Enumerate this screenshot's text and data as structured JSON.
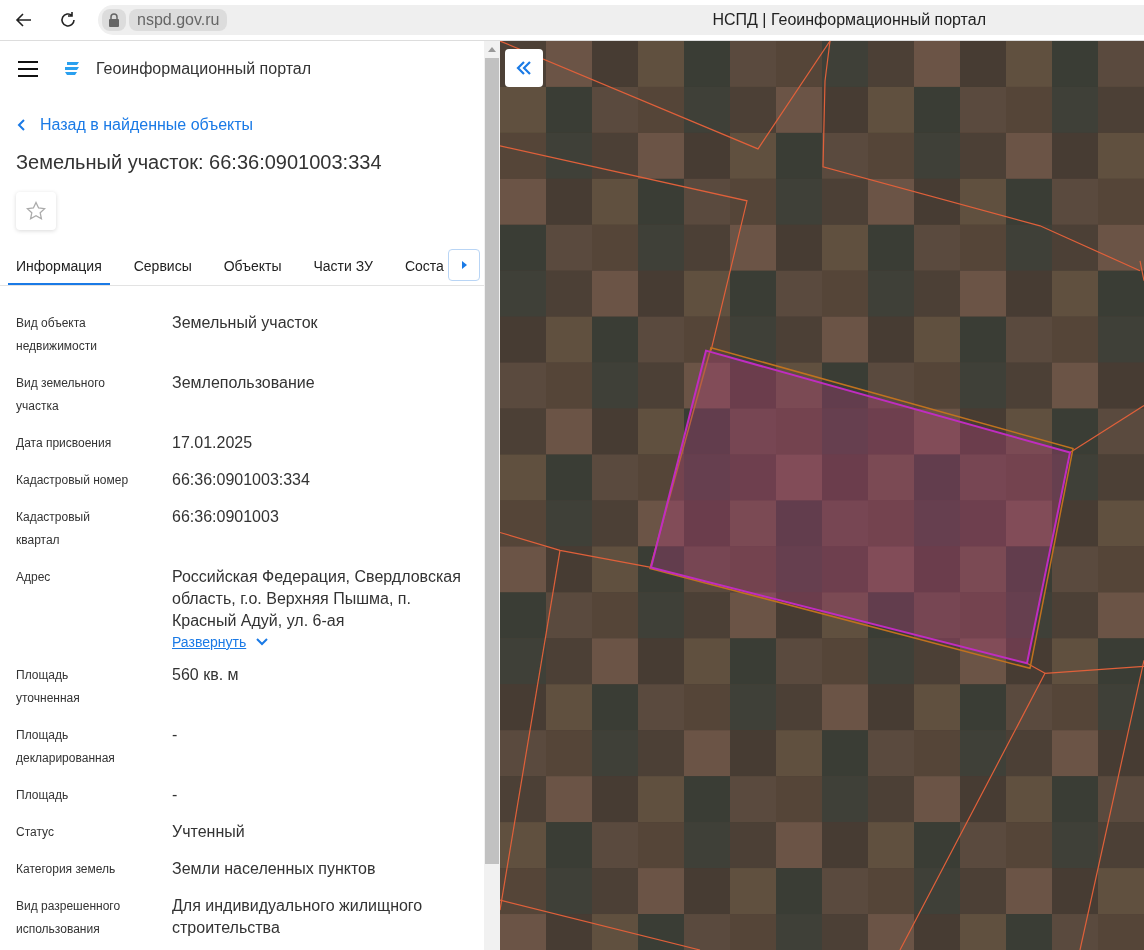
{
  "browser": {
    "url": "nspd.gov.ru",
    "page_title": "НСПД | Геоинформационный портал"
  },
  "header": {
    "title": "Геоинформационный портал"
  },
  "back_link": "Назад в найденные объекты",
  "object_title": "Земельный участок: 66:36:0901003:334",
  "favorite": false,
  "tabs": [
    {
      "label": "Информация",
      "selected": true
    },
    {
      "label": "Сервисы",
      "selected": false
    },
    {
      "label": "Объекты",
      "selected": false
    },
    {
      "label": "Части ЗУ",
      "selected": false
    },
    {
      "label": "Соста",
      "selected": false
    }
  ],
  "properties": [
    {
      "label": "Вид объекта недвижимости",
      "value": "Земельный участок"
    },
    {
      "label": "Вид земельного участка",
      "value": "Землепользование"
    },
    {
      "label": "Дата присвоения",
      "value": "17.01.2025"
    },
    {
      "label": "Кадастровый номер",
      "value": "66:36:0901003:334"
    },
    {
      "label": "Кадастровый квартал",
      "value": "66:36:0901003"
    },
    {
      "label": "Адрес",
      "value": "Российская Федерация, Свердловская область, г.о. Верхняя Пышма, п. Красный Адуй, ул. 6-ая",
      "expand_link": "Развернуть",
      "expanded": false
    },
    {
      "label": "Площадь уточненная",
      "value": "560 кв. м"
    },
    {
      "label": "Площадь декларированная",
      "value": "-"
    },
    {
      "label": "Площадь",
      "value": "-"
    },
    {
      "label": "Статус",
      "value": "Учтенный"
    },
    {
      "label": "Категория земель",
      "value": "Земли населенных пунктов"
    },
    {
      "label": "Вид разрешенного использования",
      "value": "Для индивидуального жилищного строительства"
    }
  ]
}
